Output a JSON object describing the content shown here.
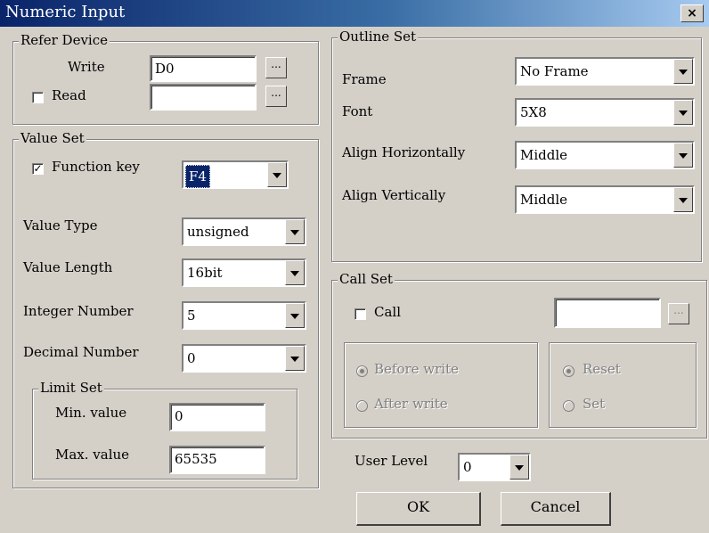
{
  "window": {
    "title": "Numeric Input",
    "close_glyph": "×"
  },
  "refer_device": {
    "legend": "Refer Device",
    "write_label": "Write",
    "write_value": "D0",
    "read_label": "Read",
    "read_value": "",
    "read_checked": false,
    "browse_glyph": "..."
  },
  "value_set": {
    "legend": "Value Set",
    "function_key_label": "Function key",
    "function_key_checked": true,
    "function_key_value": "F4",
    "value_type_label": "Value Type",
    "value_type_value": "unsigned",
    "value_length_label": "Value Length",
    "value_length_value": "16bit",
    "integer_number_label": "Integer Number",
    "integer_number_value": "5",
    "decimal_number_label": "Decimal Number",
    "decimal_number_value": "0"
  },
  "limit_set": {
    "legend": "Limit Set",
    "min_label": "Min. value",
    "min_value": "0",
    "max_label": "Max. value",
    "max_value": "65535"
  },
  "outline_set": {
    "legend": "Outline Set",
    "frame_label": "Frame",
    "frame_value": "No Frame",
    "font_label": "Font",
    "font_value": "5X8",
    "align_h_label": "Align Horizontally",
    "align_h_value": "Middle",
    "align_v_label": "Align Vertically",
    "align_v_value": "Middle"
  },
  "call_set": {
    "legend": "Call Set",
    "call_label": "Call",
    "call_checked": false,
    "call_value": "",
    "before_write_label": "Before write",
    "after_write_label": "After write",
    "reset_label": "Reset",
    "set_label": "Set"
  },
  "user_level": {
    "label": "User Level",
    "value": "0"
  },
  "buttons": {
    "ok": "OK",
    "cancel": "Cancel"
  },
  "colors": {
    "titlebar_start": "#0a246a",
    "titlebar_end": "#a6caf0",
    "dialog_bg": "#d4d0c8"
  }
}
